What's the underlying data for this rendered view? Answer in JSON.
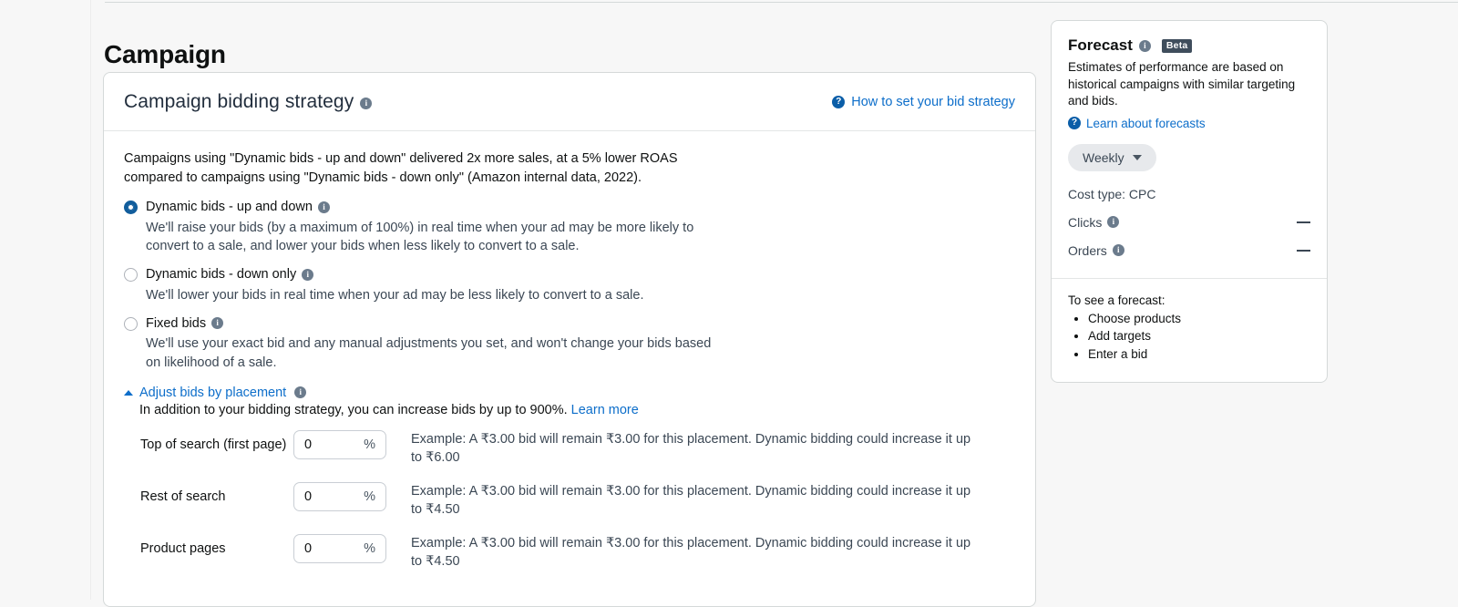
{
  "page": {
    "title": "Campaign"
  },
  "card": {
    "title": "Campaign bidding strategy",
    "info_icon": "info-icon",
    "help_link": {
      "icon": "question-circle-icon",
      "label": "How to set your bid strategy"
    },
    "intro": "Campaigns using \"Dynamic bids - up and down\" delivered 2x more sales, at a 5% lower ROAS compared to campaigns using \"Dynamic bids - down only\" (Amazon internal data, 2022).",
    "strategies": [
      {
        "label": "Dynamic bids - up and down",
        "selected": true,
        "description": "We'll raise your bids (by a maximum of 100%) in real time when your ad may be more likely to convert to a sale, and lower your bids when less likely to convert to a sale."
      },
      {
        "label": "Dynamic bids - down only",
        "selected": false,
        "description": "We'll lower your bids in real time when your ad may be less likely to convert to a sale."
      },
      {
        "label": "Fixed bids",
        "selected": false,
        "description": "We'll use your exact bid and any manual adjustments you set, and won't change your bids based on likelihood of a sale."
      }
    ],
    "adjust": {
      "toggle_label": "Adjust bids by placement",
      "expanded": true,
      "chevron_icon": "chevron-up-icon",
      "sub_text": "In addition to your bidding strategy, you can increase bids by up to 900%.",
      "learn_more_label": "Learn more",
      "placements": [
        {
          "label": "Top of search (first page)",
          "value": "0",
          "suffix": "%",
          "example": "Example: A ₹3.00 bid will remain ₹3.00 for this placement. Dynamic bidding could increase it up to ₹6.00"
        },
        {
          "label": "Rest of search",
          "value": "0",
          "suffix": "%",
          "example": "Example: A ₹3.00 bid will remain ₹3.00 for this placement. Dynamic bidding could increase it up to ₹4.50"
        },
        {
          "label": "Product pages",
          "value": "0",
          "suffix": "%",
          "example": "Example: A ₹3.00 bid will remain ₹3.00 for this placement. Dynamic bidding could increase it up to ₹4.50"
        }
      ]
    }
  },
  "forecast": {
    "title": "Forecast",
    "badge": "Beta",
    "description": "Estimates of performance are based on historical campaigns with similar targeting and bids.",
    "link_label": "Learn about forecasts",
    "period_selector": {
      "label": "Weekly",
      "chevron_icon": "chevron-down-icon"
    },
    "cost_type": "Cost type: CPC",
    "metrics": [
      {
        "label": "Clicks",
        "value": "—"
      },
      {
        "label": "Orders",
        "value": "—"
      }
    ],
    "empty_state": {
      "heading": "To see a forecast:",
      "steps": [
        "Choose products",
        "Add targets",
        "Enter a bid"
      ]
    }
  },
  "colors": {
    "accent_link": "#0d6eca",
    "radio_selected": "#115d9c",
    "badge_bg": "#3f4d5c",
    "page_bg": "#f7f7f7",
    "card_border": "#d5d9d9"
  }
}
